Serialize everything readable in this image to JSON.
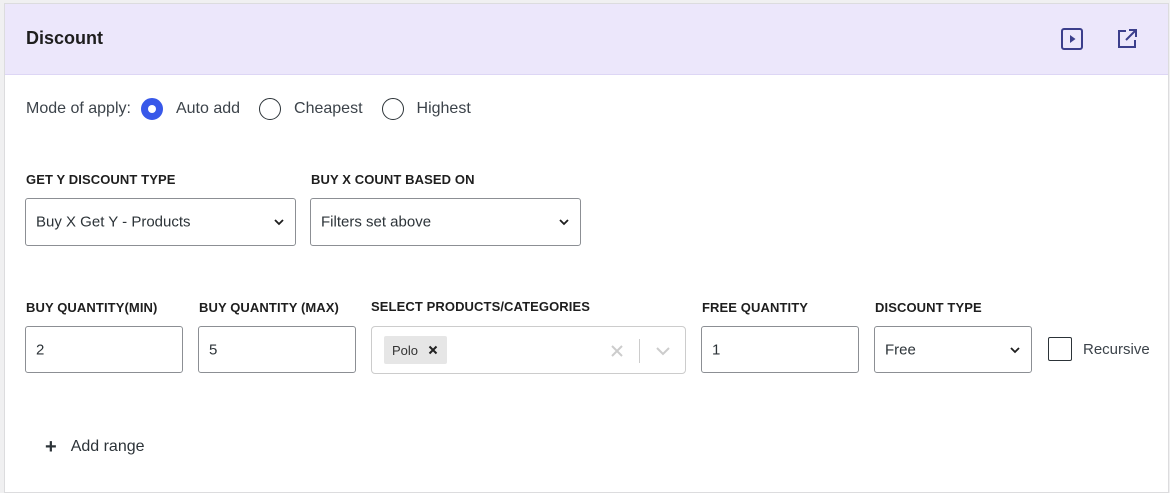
{
  "header": {
    "title": "Discount",
    "icons": [
      "play-icon",
      "external-link-icon"
    ]
  },
  "mode": {
    "label": "Mode of apply:",
    "options": [
      "Auto add",
      "Cheapest",
      "Highest"
    ],
    "selected": "Auto add"
  },
  "get_y_type": {
    "label": "GET Y DISCOUNT TYPE",
    "value": "Buy X Get Y - Products"
  },
  "buy_x_count": {
    "label": "BUY X COUNT BASED ON",
    "value": "Filters set above"
  },
  "range": {
    "buy_min": {
      "label": "BUY QUANTITY(MIN)",
      "value": "2"
    },
    "buy_max": {
      "label": "BUY QUANTITY (MAX)",
      "value": "5"
    },
    "products": {
      "label": "SELECT PRODUCTS/CATEGORIES",
      "tags": [
        "Polo"
      ]
    },
    "free_qty": {
      "label": "FREE QUANTITY",
      "value": "1"
    },
    "discount_type": {
      "label": "DISCOUNT TYPE",
      "value": "Free"
    },
    "recursive": {
      "label": "Recursive",
      "checked": false
    }
  },
  "add_range": {
    "icon": "+",
    "label": "Add range"
  },
  "colors": {
    "accent": "#3858e9",
    "header_bg": "#ece7fb"
  }
}
